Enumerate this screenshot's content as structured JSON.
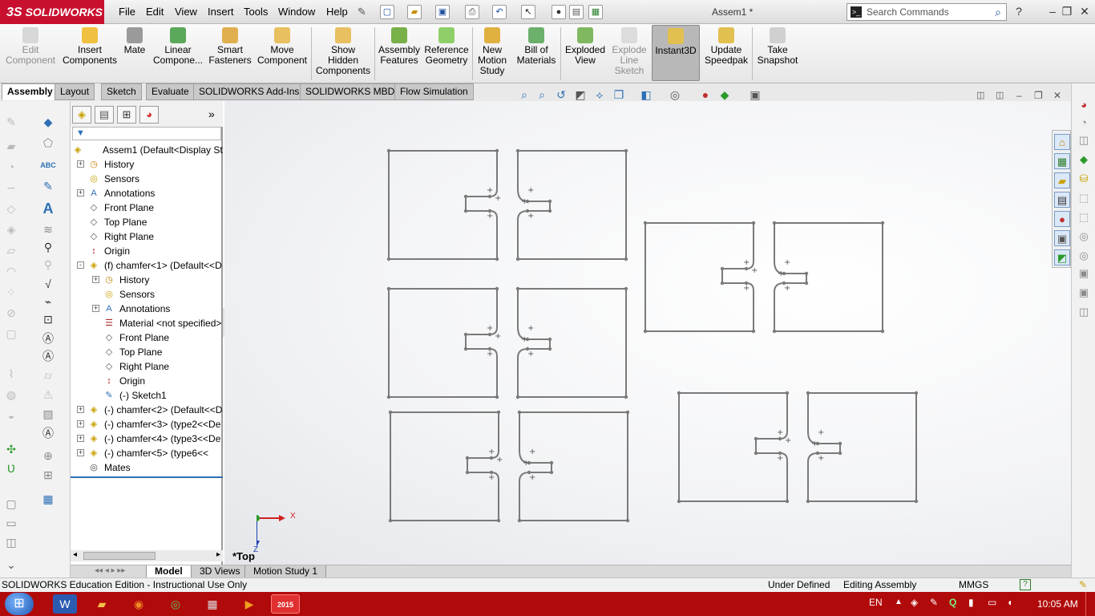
{
  "app": {
    "brand": "SOLIDWORKS",
    "brand_prefix": "3S",
    "document_title": "Assem1 *"
  },
  "menus": [
    "File",
    "Edit",
    "View",
    "Insert",
    "Tools",
    "Window",
    "Help"
  ],
  "search": {
    "placeholder": "Search Commands"
  },
  "commands": [
    {
      "label": "Edit Component",
      "lines": [
        "Edit",
        "Component"
      ],
      "disabled": true,
      "active": false
    },
    {
      "label": "Insert Components",
      "lines": [
        "Insert",
        "Components"
      ],
      "disabled": false,
      "active": false
    },
    {
      "label": "Mate",
      "lines": [
        "Mate"
      ],
      "disabled": false,
      "active": false
    },
    {
      "label": "Linear Compone...",
      "lines": [
        "Linear",
        "Compone..."
      ],
      "disabled": false,
      "active": false
    },
    {
      "label": "Smart Fasteners",
      "lines": [
        "Smart",
        "Fasteners"
      ],
      "disabled": false,
      "active": false
    },
    {
      "label": "Move Component",
      "lines": [
        "Move",
        "Component"
      ],
      "disabled": false,
      "active": false
    },
    {
      "label": "Show Hidden Components",
      "lines": [
        "Show",
        "Hidden",
        "Components"
      ],
      "disabled": false,
      "active": false
    },
    {
      "label": "Assembly Features",
      "lines": [
        "Assembly",
        "Features"
      ],
      "disabled": false,
      "active": false
    },
    {
      "label": "Reference Geometry",
      "lines": [
        "Reference",
        "Geometry"
      ],
      "disabled": false,
      "active": false
    },
    {
      "label": "New Motion Study",
      "lines": [
        "New",
        "Motion",
        "Study"
      ],
      "disabled": false,
      "active": false
    },
    {
      "label": "Bill of Materials",
      "lines": [
        "Bill of",
        "Materials"
      ],
      "disabled": false,
      "active": false
    },
    {
      "label": "Exploded View",
      "lines": [
        "Exploded",
        "View"
      ],
      "disabled": false,
      "active": false
    },
    {
      "label": "Explode Line Sketch",
      "lines": [
        "Explode",
        "Line",
        "Sketch"
      ],
      "disabled": true,
      "active": false
    },
    {
      "label": "Instant3D",
      "lines": [
        "Instant3D"
      ],
      "disabled": false,
      "active": true
    },
    {
      "label": "Update Speedpak",
      "lines": [
        "Update",
        "Speedpak"
      ],
      "disabled": false,
      "active": false
    },
    {
      "label": "Take Snapshot",
      "lines": [
        "Take",
        "Snapshot"
      ],
      "disabled": false,
      "active": false
    }
  ],
  "command_tabs": [
    {
      "label": "Assembly",
      "selected": true
    },
    {
      "label": "Layout",
      "selected": false
    },
    {
      "label": "Sketch",
      "selected": false
    },
    {
      "label": "Evaluate",
      "selected": false
    },
    {
      "label": "SOLIDWORKS Add-Ins",
      "selected": false
    },
    {
      "label": "SOLIDWORKS MBD",
      "selected": false
    },
    {
      "label": "Flow Simulation",
      "selected": false
    }
  ],
  "feature_tree": [
    {
      "level": 0,
      "expander": "",
      "icon": "assembly-icon",
      "label": "Assem1  (Default<Display St"
    },
    {
      "level": 1,
      "expander": "+",
      "icon": "history-icon",
      "label": "History"
    },
    {
      "level": 1,
      "expander": "",
      "icon": "sensors-icon",
      "label": "Sensors"
    },
    {
      "level": 1,
      "expander": "+",
      "icon": "annotations-icon",
      "label": "Annotations"
    },
    {
      "level": 1,
      "expander": "",
      "icon": "plane-icon",
      "label": "Front Plane"
    },
    {
      "level": 1,
      "expander": "",
      "icon": "plane-icon",
      "label": "Top Plane"
    },
    {
      "level": 1,
      "expander": "",
      "icon": "plane-icon",
      "label": "Right Plane"
    },
    {
      "level": 1,
      "expander": "",
      "icon": "origin-icon",
      "label": "Origin"
    },
    {
      "level": 1,
      "expander": "-",
      "icon": "part-icon",
      "label": "(f) chamfer<1> (Default<<D"
    },
    {
      "level": 2,
      "expander": "+",
      "icon": "history-icon",
      "label": "History"
    },
    {
      "level": 2,
      "expander": "",
      "icon": "sensors-icon",
      "label": "Sensors"
    },
    {
      "level": 2,
      "expander": "+",
      "icon": "annotations-icon",
      "label": "Annotations"
    },
    {
      "level": 2,
      "expander": "",
      "icon": "material-icon",
      "label": "Material <not specified>"
    },
    {
      "level": 2,
      "expander": "",
      "icon": "plane-icon",
      "label": "Front Plane"
    },
    {
      "level": 2,
      "expander": "",
      "icon": "plane-icon",
      "label": "Top Plane"
    },
    {
      "level": 2,
      "expander": "",
      "icon": "plane-icon",
      "label": "Right Plane"
    },
    {
      "level": 2,
      "expander": "",
      "icon": "origin-icon",
      "label": "Origin"
    },
    {
      "level": 2,
      "expander": "",
      "icon": "sketch-icon",
      "label": "(-) Sketch1"
    },
    {
      "level": 1,
      "expander": "+",
      "icon": "part-icon",
      "label": "(-) chamfer<2> (Default<<D"
    },
    {
      "level": 1,
      "expander": "+",
      "icon": "part-icon",
      "label": "(-) chamfer<3> (type2<<De"
    },
    {
      "level": 1,
      "expander": "+",
      "icon": "part-icon",
      "label": "(-) chamfer<4> (type3<<De"
    },
    {
      "level": 1,
      "expander": "+",
      "icon": "part-icon",
      "label": "(-) chamfer<5> (type6<<"
    },
    {
      "level": 1,
      "expander": "",
      "icon": "mates-icon",
      "label": "Mates"
    }
  ],
  "viewport": {
    "view_label": "*Top",
    "triad": {
      "x": "X",
      "z": "Z"
    }
  },
  "model_tabs": [
    {
      "label": "Model",
      "selected": true
    },
    {
      "label": "3D Views",
      "selected": false
    },
    {
      "label": "Motion Study 1",
      "selected": false
    }
  ],
  "status": {
    "edition": "SOLIDWORKS Education Edition - Instructional Use Only",
    "definition": "Under Defined",
    "mode": "Editing Assembly",
    "units": "MMGS",
    "help": "?"
  },
  "taskbar": {
    "language": "EN",
    "time": "10:05 AM",
    "sw_badge": "2015"
  },
  "colors": {
    "brand_red": "#c8102e",
    "taskbar_red": "#b10a0a",
    "sketch_line": "#7a7a7a"
  }
}
